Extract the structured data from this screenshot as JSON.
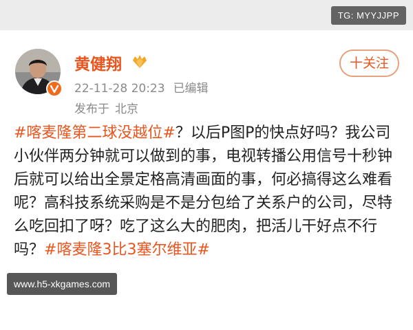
{
  "watermarks": {
    "top_right": "TG: MYYJJPP",
    "bottom_left": "www.h5-xkgames.com"
  },
  "post": {
    "author": {
      "name": "黄健翔",
      "avatar_icon": "avatar-photo",
      "verified_icon": "verified-badge-icon",
      "vip_icon": "vip-icon"
    },
    "timestamp": "22-11-28 20:23",
    "edited_label": "已编辑",
    "location_prefix": "发布于",
    "location": "北京",
    "follow_label": "十关注",
    "content": {
      "hashtag_1": "#喀麦隆第二球没越位#",
      "text": "？以后P图P的快点好吗？我公司小伙伴两分钟就可以做到的事，电视转播公用信号十秒钟后就可以给出全景定格高清画面的事，何必搞得这么难看呢？高科技系统采购是不是分包给了关系户的公司，尽特么吃回扣了呀？吃了这么大的肥肉，把活儿干好点不行吗？",
      "hashtag_2": "#喀麦隆3比3塞尔维亚#"
    }
  },
  "colors": {
    "accent": "#e8551f",
    "meta_text": "#8a8a8a",
    "body_text": "#222222",
    "top_strip": "#ececec"
  }
}
